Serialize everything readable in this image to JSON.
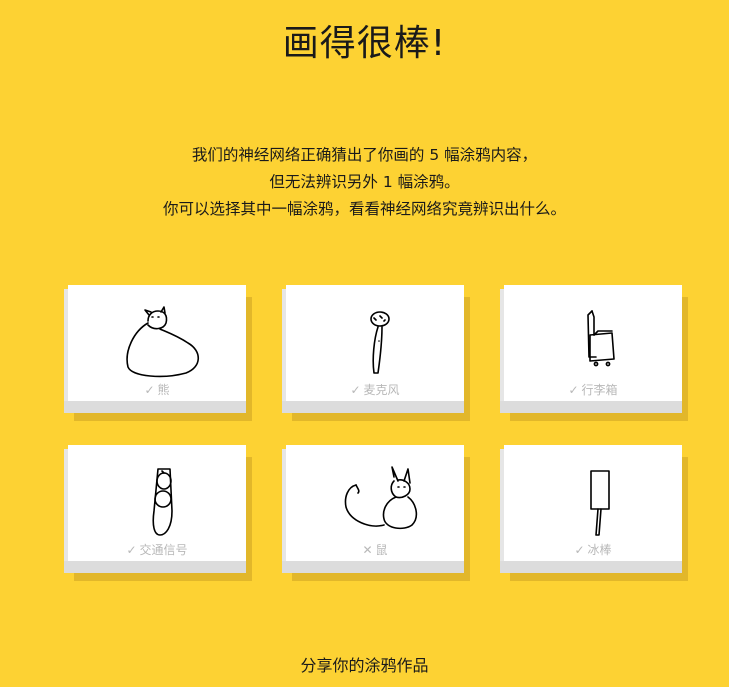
{
  "header": {
    "title": "画得很棒!"
  },
  "message": {
    "line1": "我们的神经网络正确猜出了你画的 5 幅涂鸦内容，",
    "line2": "但无法辨识另外 1 幅涂鸦。",
    "line3": "你可以选择其中一幅涂鸦，看看神经网络究竟辨识出什么。"
  },
  "drawings": [
    {
      "label": "熊",
      "status": "✓",
      "recognized": true,
      "icon": "bear-doodle-icon"
    },
    {
      "label": "麦克风",
      "status": "✓",
      "recognized": true,
      "icon": "microphone-doodle-icon"
    },
    {
      "label": "行李箱",
      "status": "✓",
      "recognized": true,
      "icon": "suitcase-doodle-icon"
    },
    {
      "label": "交通信号",
      "status": "✓",
      "recognized": true,
      "icon": "traffic-light-doodle-icon"
    },
    {
      "label": "鼠",
      "status": "✕",
      "recognized": false,
      "icon": "mouse-doodle-icon"
    },
    {
      "label": "冰棒",
      "status": "✓",
      "recognized": true,
      "icon": "popsicle-doodle-icon"
    }
  ],
  "footer": {
    "share_label": "分享你的涂鸦作品"
  },
  "colors": {
    "background": "#fdd233",
    "card": "#ffffff",
    "label": "#b8b8b8"
  }
}
